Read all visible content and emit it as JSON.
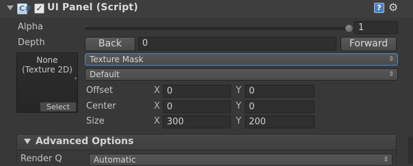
{
  "header": {
    "title": "UI Panel (Script)",
    "script_glyph": "C#",
    "check_mark": "✓",
    "help_glyph": "?",
    "gear_glyph": "⚙"
  },
  "alpha": {
    "label": "Alpha",
    "value": "1",
    "slider_fraction": 1.0
  },
  "depth": {
    "label": "Depth",
    "back_label": "Back",
    "value": "0",
    "forward_label": "Forward"
  },
  "texture": {
    "line1": "None",
    "line2": "(Texture 2D)",
    "select_label": "Select"
  },
  "mask_dropdown": {
    "value": "Texture Mask",
    "arrow": "⇕"
  },
  "blend_dropdown": {
    "value": "Default",
    "arrow": "⇕"
  },
  "offset": {
    "label": "Offset",
    "x_axis": "X",
    "x": "0",
    "y_axis": "Y",
    "y": "0"
  },
  "center": {
    "label": "Center",
    "x_axis": "X",
    "x": "0",
    "y_axis": "Y",
    "y": "0"
  },
  "size": {
    "label": "Size",
    "x_axis": "X",
    "x": "300",
    "y_axis": "Y",
    "y": "200"
  },
  "advanced": {
    "label": "Advanced Options",
    "render_q_label": "Render Q",
    "render_q_value": "Automatic",
    "arrow": "⇕"
  },
  "colors": {
    "panel_bg": "#383838",
    "focus_border": "#4f88d0",
    "help_blue": "#4f7fba"
  }
}
